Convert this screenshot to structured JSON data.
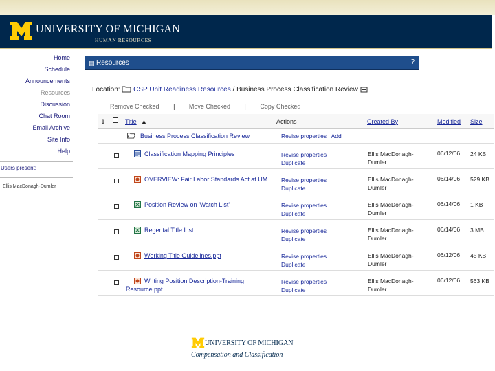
{
  "header": {
    "university": "UNIVERSITY OF MICHIGAN",
    "department": "HUMAN RESOURCES",
    "colors": {
      "navy": "#00274c",
      "maize": "#ffcb05"
    }
  },
  "sidebar": {
    "items": [
      {
        "label": "Home"
      },
      {
        "label": "Schedule"
      },
      {
        "label": "Announcements"
      },
      {
        "label": "Resources"
      },
      {
        "label": "Discussion"
      },
      {
        "label": "Chat Room"
      },
      {
        "label": "Email Archive"
      },
      {
        "label": "Site Info"
      },
      {
        "label": "Help"
      }
    ],
    "users_present_label": "Users present:",
    "user": "Ellis MacDonagh-Dumler"
  },
  "resources_bar": {
    "title": "Resources",
    "help": "?"
  },
  "location": {
    "label": "Location:",
    "folder": "CSP Unit Readiness Resources",
    "separator": "/",
    "current": "Business Process Classification Review"
  },
  "toolbar": {
    "remove": "Remove Checked",
    "move": "Move Checked",
    "copy": "Copy Checked",
    "separator": "|"
  },
  "table": {
    "headers": {
      "title": "Title",
      "actions": "Actions",
      "created_by": "Created By",
      "modified": "Modified",
      "size": "Size"
    },
    "folder_row": {
      "title": "Business Process Classification Review",
      "actions": "Revise properties | Add"
    },
    "rows": [
      {
        "title": "Classification Mapping Principles",
        "icon": "word-doc-icon",
        "action1": "Revise properties |",
        "action2": "Duplicate",
        "creator1": "Ellis MacDonagh-",
        "creator2": "Dumler",
        "modified": "06/12/06",
        "size": "24 KB"
      },
      {
        "title": "OVERVIEW: Fair Labor Standards Act at UM",
        "icon": "powerpoint-icon",
        "action1": "Revise properties |",
        "action2": "Duplicate",
        "creator1": "Ellis MacDonagh-",
        "creator2": "Dumler",
        "modified": "06/14/06",
        "size": "529 KB"
      },
      {
        "title": "Position Review on 'Watch List'",
        "icon": "excel-icon",
        "action1": "Revise properties |",
        "action2": "Duplicate",
        "creator1": "Ellis MacDonagh-",
        "creator2": "Dumler",
        "modified": "06/14/06",
        "size": "1 KB"
      },
      {
        "title": "Regental Title List",
        "icon": "excel-icon",
        "action1": "Revise properties |",
        "action2": "Duplicate",
        "creator1": "Ellis MacDonagh-",
        "creator2": "Dumler",
        "modified": "06/14/06",
        "size": "3 MB"
      },
      {
        "title": "Working Title Guidelines.ppt",
        "icon": "powerpoint-icon",
        "action1": "Revise properties |",
        "action2": "Duplicate",
        "creator1": "Ellis MacDonagh-",
        "creator2": "Dumler",
        "modified": "06/12/06",
        "size": "45 KB"
      },
      {
        "title": "Writing Position Description-Training Resource.ppt",
        "icon": "powerpoint-icon",
        "action1": "Revise properties |",
        "action2": "Duplicate",
        "creator1": "Ellis MacDonagh-",
        "creator2": "Dumler",
        "modified": "06/12/06",
        "size": "563 KB"
      }
    ]
  },
  "footer": {
    "university": "UNIVERSITY OF MICHIGAN",
    "subtitle": "Compensation and Classification"
  }
}
